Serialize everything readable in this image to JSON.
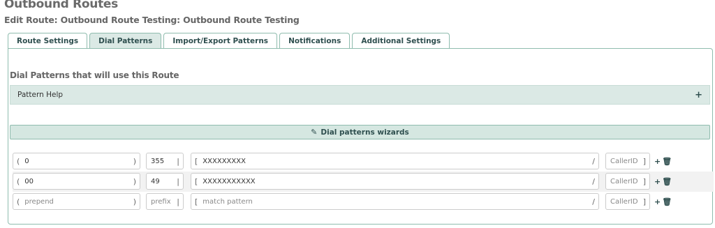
{
  "page": {
    "title": "Outbound Routes",
    "subtitle": "Edit Route: Outbound Route Testing: Outbound Route Testing"
  },
  "tabs": [
    {
      "label": "Route Settings",
      "active": false
    },
    {
      "label": "Dial Patterns",
      "active": true
    },
    {
      "label": "Import/Export Patterns",
      "active": false
    },
    {
      "label": "Notifications",
      "active": false
    },
    {
      "label": "Additional Settings",
      "active": false
    }
  ],
  "section": {
    "title": "Dial Patterns that will use this Route",
    "help_label": "Pattern Help",
    "help_toggle": "+",
    "wizard_label": "Dial patterns wizards"
  },
  "brackets": {
    "open_paren": "(",
    "close_paren": ")",
    "pipe": "|",
    "open_square": "[",
    "slash": "/",
    "close_square": "]"
  },
  "icons": {
    "add": "+",
    "delete": "🗑",
    "wand": "✎"
  },
  "patterns": [
    {
      "prepend": "0",
      "prefix": "355",
      "match": "XXXXXXXXX",
      "callerid": "",
      "placeholders": {
        "prepend": "prepend",
        "prefix": "prefix",
        "match": "match pattern",
        "callerid": "CallerID"
      }
    },
    {
      "prepend": "00",
      "prefix": "49",
      "match": "XXXXXXXXXXX",
      "callerid": "",
      "placeholders": {
        "prepend": "prepend",
        "prefix": "prefix",
        "match": "match pattern",
        "callerid": "CallerID"
      }
    },
    {
      "prepend": "",
      "prefix": "",
      "match": "",
      "callerid": "",
      "placeholders": {
        "prepend": "prepend",
        "prefix": "prefix",
        "match": "match pattern",
        "callerid": "CallerID"
      }
    }
  ],
  "colors": {
    "accent": "#8fbcae",
    "tab_active_bg": "#dbe9e5",
    "text_dark": "#2f4f4f"
  }
}
